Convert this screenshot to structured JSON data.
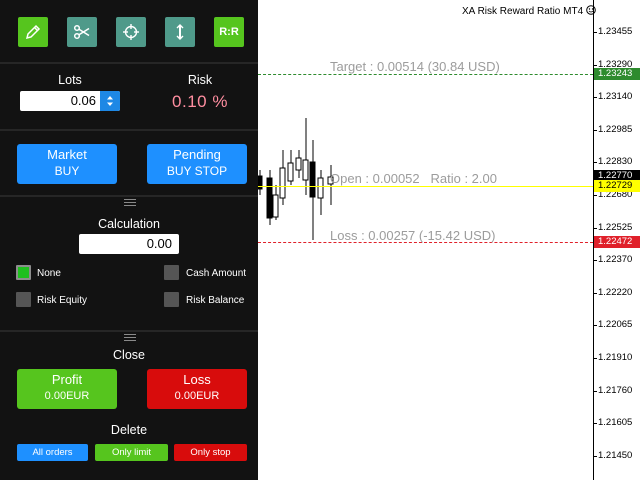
{
  "toolbar": {
    "buttons": [
      {
        "icon": "pencil-icon",
        "color": "#56c51e"
      },
      {
        "icon": "scissors-icon",
        "color": "#4f9a8a"
      },
      {
        "icon": "crosshair-icon",
        "color": "#4f9a8a"
      },
      {
        "icon": "vertical-arrow-icon",
        "color": "#4f9a8a"
      },
      {
        "icon": "rr-icon",
        "label": "R:R",
        "color": "#56c51e"
      }
    ]
  },
  "lots": {
    "label": "Lots",
    "value": "0.06"
  },
  "risk": {
    "label": "Risk",
    "value": "0.10 %"
  },
  "orders": {
    "market": {
      "line1": "Market",
      "line2": "BUY"
    },
    "pending": {
      "line1": "Pending",
      "line2": "BUY STOP"
    }
  },
  "calculation": {
    "label": "Calculation",
    "value": "0.00",
    "options": [
      {
        "label": "None",
        "checked": true
      },
      {
        "label": "Cash Amount",
        "checked": false
      },
      {
        "label": "Risk Equity",
        "checked": false
      },
      {
        "label": "Risk Balance",
        "checked": false
      }
    ]
  },
  "close": {
    "label": "Close",
    "profit": {
      "line1": "Profit",
      "line2": "0.00EUR"
    },
    "loss": {
      "line1": "Loss",
      "line2": "0.00EUR"
    }
  },
  "delete": {
    "label": "Delete",
    "all": "All orders",
    "limit": "Only limit",
    "stop": "Only stop"
  },
  "chart": {
    "title": "XA Risk Reward Ratio MT4",
    "target_text": "Target : 0.00514 (30.84 USD)",
    "open_text": "Open : 0.00052",
    "ratio_text": "Ratio : 2.00",
    "loss_text": "Loss : 0.00257 (-15.42 USD)",
    "price_labels": [
      "1.23455",
      "1.23290",
      "1.23140",
      "1.22985",
      "1.22830",
      "1.22680",
      "1.22525",
      "1.22370",
      "1.22220",
      "1.22065",
      "1.21910",
      "1.21760",
      "1.21605",
      "1.21450"
    ],
    "target_tag": "1.23243",
    "bid_tag": "1.22770",
    "open_tag": "1.22729",
    "loss_tag": "1.22472",
    "colors": {
      "target": "#2e8b2e",
      "open": "#ffff00",
      "loss": "#e0202a",
      "bid": "#000000"
    }
  }
}
